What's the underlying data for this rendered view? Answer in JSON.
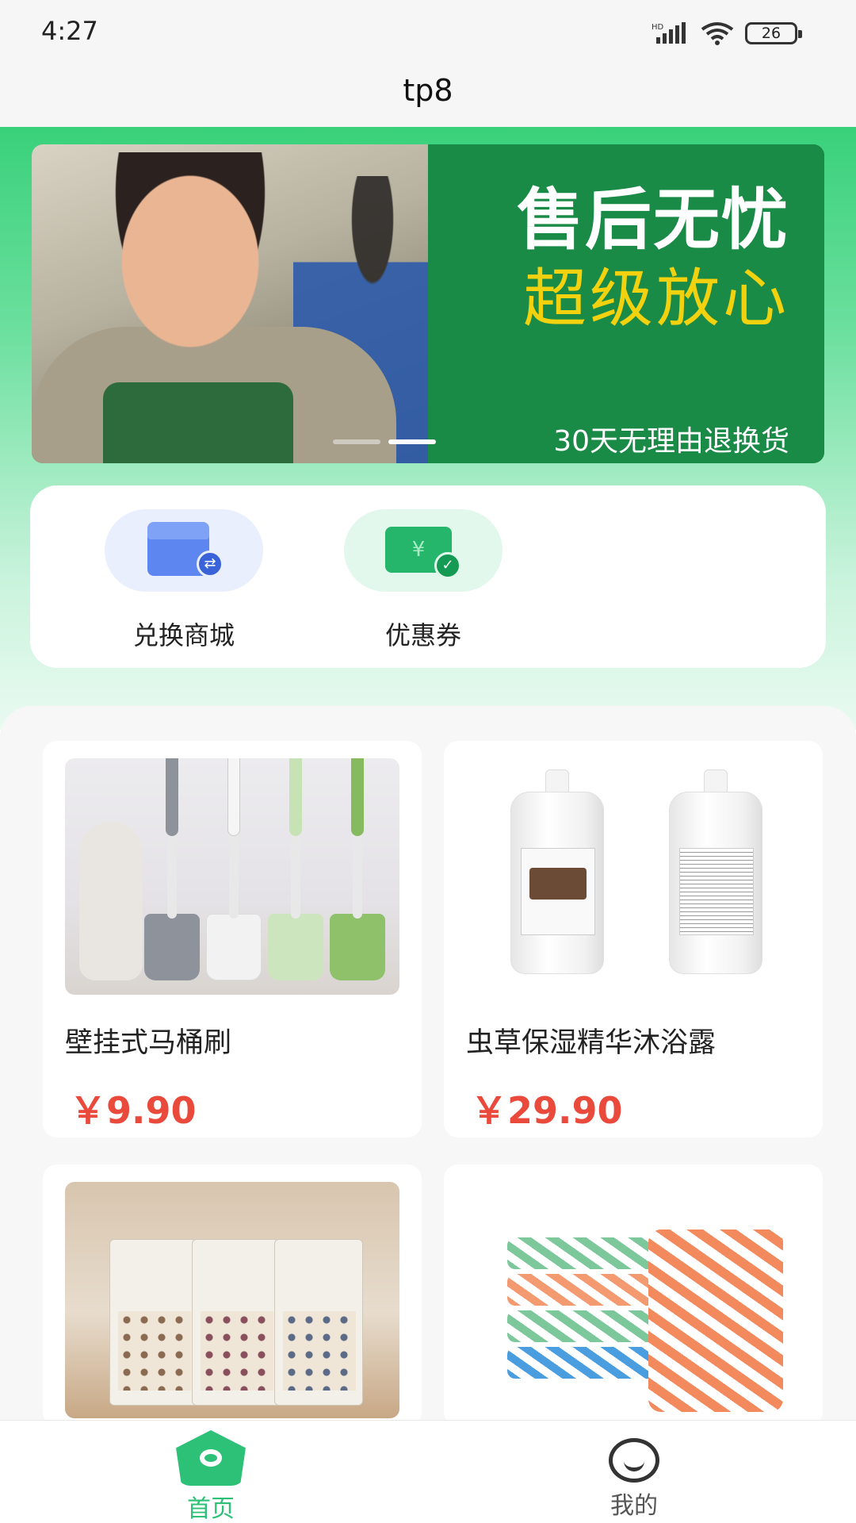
{
  "status_bar": {
    "time": "4:27",
    "network": "HD",
    "battery": "26",
    "icons": [
      "signal-icon",
      "wifi-icon",
      "battery-icon"
    ]
  },
  "app_bar": {
    "title": "tp8"
  },
  "banner": {
    "headline": "售后无忧",
    "subheadline": "超级放心",
    "caption": "30天无理由退换货",
    "active_slide": 2,
    "slide_count": 2,
    "colors": {
      "green": "#1a8a47",
      "yellow": "#f2d20f"
    }
  },
  "quick_actions": [
    {
      "label": "兑换商城",
      "icon": "shop-exchange-icon"
    },
    {
      "label": "优惠券",
      "icon": "coupon-icon"
    }
  ],
  "products": [
    {
      "name": "壁挂式马桶刷",
      "price": "￥9.90",
      "image": "toilet-brush-image"
    },
    {
      "name": "虫草保湿精华沐浴露",
      "price": "￥29.90",
      "image": "body-wash-image"
    },
    {
      "name": "",
      "price": "",
      "image": "cleaning-cloth-image"
    },
    {
      "name": "",
      "price": "",
      "image": "towel-image"
    }
  ],
  "bottom_nav": {
    "items": [
      {
        "label": "首页",
        "icon": "home-icon",
        "active": true
      },
      {
        "label": "我的",
        "icon": "profile-icon",
        "active": false
      }
    ],
    "accent": "#2dc178"
  },
  "colors": {
    "price": "#ea4a3b",
    "header_green": "#39d17a"
  }
}
